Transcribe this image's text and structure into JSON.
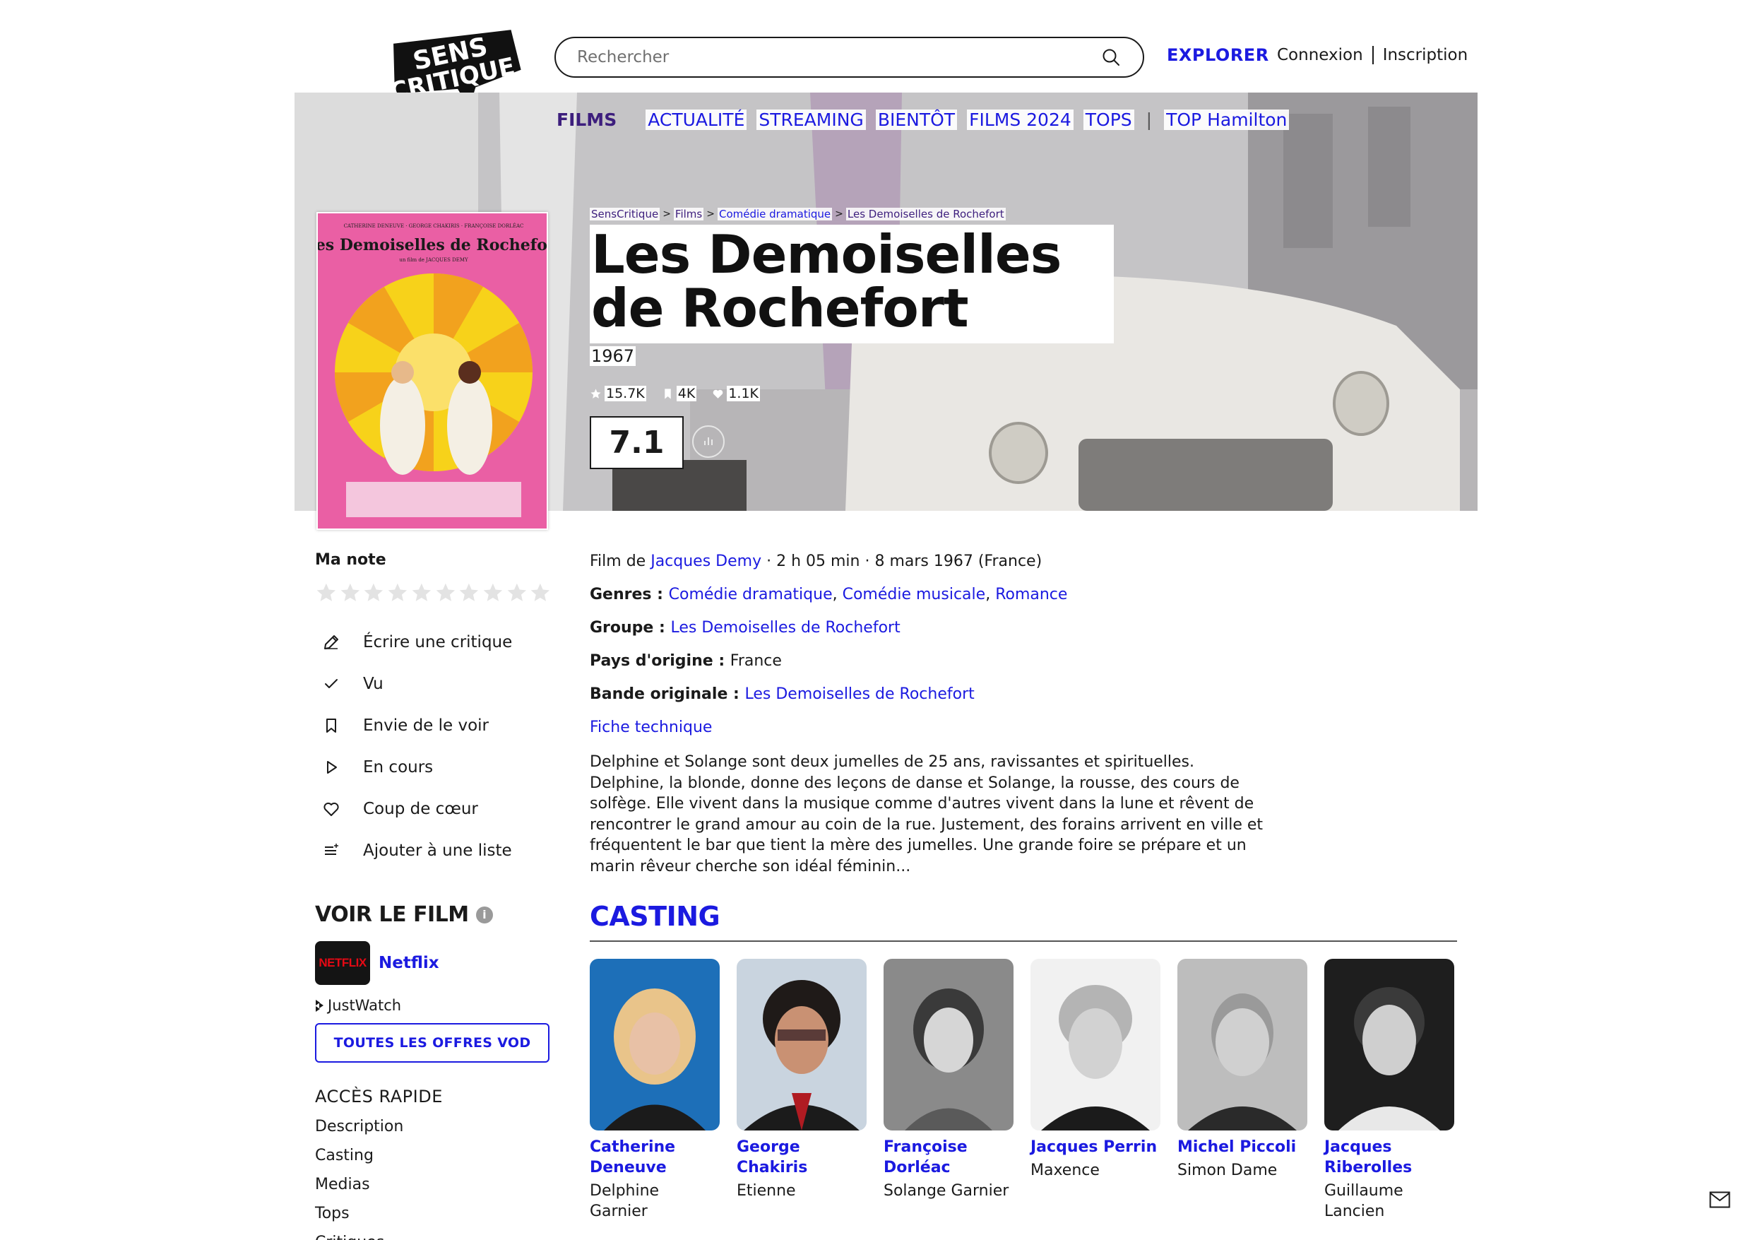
{
  "header": {
    "search_placeholder": "Rechercher",
    "explore_label": "EXPLORER",
    "login_label": "Connexion",
    "signup_label": "Inscription"
  },
  "subnav": {
    "items": [
      "FILMS",
      "ACTUALITÉ",
      "STREAMING",
      "BIENTÔT",
      "FILMS 2024",
      "TOPS",
      "TOP Hamilton"
    ]
  },
  "breadcrumb": [
    "SensCritique",
    "Films",
    "Comédie dramatique",
    "Les Demoiselles de Rochefort"
  ],
  "movie": {
    "title": "Les Demoiselles de Rochefort",
    "year": "1967",
    "ratings_count": "15.7K",
    "wishlist_count": "4K",
    "favorites_count": "1.1K",
    "score": "7.1",
    "film_de_label": "Film de ",
    "director": "Jacques Demy",
    "duration_date": " · 2 h 05 min · 8 mars 1967 (France)",
    "genres_label": "Genres : ",
    "genres": [
      "Comédie dramatique",
      "Comédie musicale",
      "Romance"
    ],
    "groupe_label": "Groupe : ",
    "groupe": "Les Demoiselles de Rochefort",
    "pays_label": "Pays d'origine : ",
    "pays": "France",
    "bande_label": "Bande originale : ",
    "bande": "Les Demoiselles de Rochefort",
    "fiche_technique": "Fiche technique",
    "synopsis": "Delphine et Solange sont deux jumelles de 25 ans, ravissantes et spirituelles. Delphine, la blonde, donne des leçons de danse et Solange, la rousse, des cours de solfège. Elle vivent dans la musique comme d'autres vivent dans la lune et rêvent de rencontrer le grand amour au coin de la rue. Justement, des forains arrivent en ville et fréquentent le bar que tient la mère des jumelles. Une grande foire se prépare et un marin rêveur cherche son idéal féminin..."
  },
  "sidebar": {
    "my_note_label": "Ma note",
    "actions": [
      {
        "label": "Écrire une critique",
        "icon": "pencil-icon"
      },
      {
        "label": "Vu",
        "icon": "check-icon"
      },
      {
        "label": "Envie de le voir",
        "icon": "bookmark-icon"
      },
      {
        "label": "En cours",
        "icon": "play-icon"
      },
      {
        "label": "Coup de cœur",
        "icon": "heart-icon"
      },
      {
        "label": "Ajouter à une liste",
        "icon": "list-add-icon"
      }
    ],
    "voir_le_film": "VOIR LE FILM",
    "provider_name": "Netflix",
    "provider_logo_text": "NETFLIX",
    "justwatch": "JustWatch",
    "vod_button": "TOUTES LES OFFRES VOD",
    "quick_access_title": "ACCÈS RAPIDE",
    "quick_links": [
      "Description",
      "Casting",
      "Medias",
      "Tops",
      "Critiques"
    ]
  },
  "casting": {
    "title": "CASTING",
    "members": [
      {
        "name": "Catherine Deneuve",
        "role": "Delphine Garnier"
      },
      {
        "name": "George Chakiris",
        "role": "Etienne"
      },
      {
        "name": "Françoise Dorléac",
        "role": "Solange Garnier"
      },
      {
        "name": "Jacques Perrin",
        "role": "Maxence"
      },
      {
        "name": "Michel Piccoli",
        "role": "Simon Dame"
      },
      {
        "name": "Jacques Riberolles",
        "role": "Guillaume Lancien"
      }
    ]
  },
  "poster": {
    "top_credits": "CATHERINE DENEUVE · GEORGE CHAKIRIS · FRANÇOISE DORLÉAC",
    "title": "Les Demoiselles de Rochefort",
    "byline": "un film de JACQUES DEMY"
  },
  "logo_text": [
    "SENS",
    "CRITIQUE"
  ],
  "colors": {
    "accent": "#1b1ae0",
    "nav_active": "#3d1e7d",
    "netflix_red": "#e50914",
    "poster_pink": "#ea5fa4"
  }
}
